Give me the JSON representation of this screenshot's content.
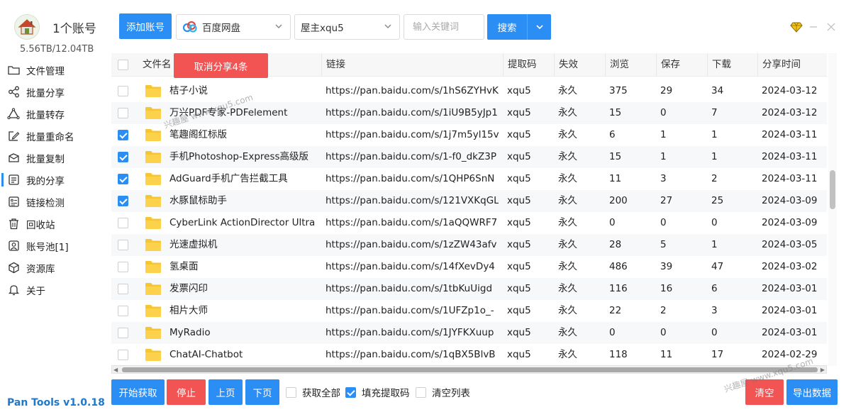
{
  "account": {
    "name": "1个账号",
    "storage": "5.56TB/12.04TB"
  },
  "sidebar": {
    "items": [
      {
        "label": "文件管理",
        "icon": "folder-icon"
      },
      {
        "label": "批量分享",
        "icon": "share-icon"
      },
      {
        "label": "批量转存",
        "icon": "transfer-icon"
      },
      {
        "label": "批量重命名",
        "icon": "rename-icon"
      },
      {
        "label": "批量复制",
        "icon": "copy-icon"
      },
      {
        "label": "我的分享",
        "icon": "my-share-icon"
      },
      {
        "label": "链接检测",
        "icon": "link-check-icon"
      },
      {
        "label": "回收站",
        "icon": "trash-icon"
      },
      {
        "label": "账号池[1]",
        "icon": "account-pool-icon"
      },
      {
        "label": "资源库",
        "icon": "cube-icon"
      },
      {
        "label": "关于",
        "icon": "bell-icon"
      }
    ],
    "active_index": 5
  },
  "version": "Pan Tools v1.0.18",
  "toolbar": {
    "add_account": "添加账号",
    "pan_select": "百度网盘",
    "user_select": "屋主xqu5",
    "search_placeholder": "输入关键词",
    "search_label": "搜索"
  },
  "table": {
    "headers": [
      "文件名",
      "链接",
      "提取码",
      "失效",
      "浏览",
      "保存",
      "下载",
      "分享时间"
    ],
    "cancel_share_label": "取消分享4条",
    "rows": [
      {
        "checked": false,
        "name": "桔子小说",
        "link": "https://pan.baidu.com/s/1hS6ZYHvK",
        "code": "xqu5",
        "expire": "永久",
        "views": "375",
        "saves": "29",
        "downloads": "34",
        "time": "2024-03-12"
      },
      {
        "checked": false,
        "name": "万兴PDF专家-PDFelement",
        "link": "https://pan.baidu.com/s/1iU9B5yJp1",
        "code": "xqu5",
        "expire": "永久",
        "views": "15",
        "saves": "0",
        "downloads": "7",
        "time": "2024-03-12"
      },
      {
        "checked": true,
        "name": "笔趣阁红标版",
        "link": "https://pan.baidu.com/s/1j7m5yl15v",
        "code": "xqu5",
        "expire": "永久",
        "views": "6",
        "saves": "1",
        "downloads": "1",
        "time": "2024-03-11"
      },
      {
        "checked": true,
        "name": "手机Photoshop-Express高级版",
        "link": "https://pan.baidu.com/s/1-f0_dkZ3P",
        "code": "xqu5",
        "expire": "永久",
        "views": "15",
        "saves": "1",
        "downloads": "1",
        "time": "2024-03-11"
      },
      {
        "checked": true,
        "name": "AdGuard手机广告拦截工具",
        "link": "https://pan.baidu.com/s/1QHP6SnN",
        "code": "xqu5",
        "expire": "永久",
        "views": "11",
        "saves": "3",
        "downloads": "2",
        "time": "2024-03-11"
      },
      {
        "checked": true,
        "name": "水豚鼠标助手",
        "link": "https://pan.baidu.com/s/121VXKqGL",
        "code": "xqu5",
        "expire": "永久",
        "views": "200",
        "saves": "27",
        "downloads": "25",
        "time": "2024-03-09"
      },
      {
        "checked": false,
        "name": "CyberLink ActionDirector Ultra",
        "link": "https://pan.baidu.com/s/1aQQWRF7",
        "code": "xqu5",
        "expire": "永久",
        "views": "0",
        "saves": "0",
        "downloads": "0",
        "time": "2024-03-09"
      },
      {
        "checked": false,
        "name": "光速虚拟机",
        "link": "https://pan.baidu.com/s/1zZW43afv",
        "code": "xqu5",
        "expire": "永久",
        "views": "28",
        "saves": "5",
        "downloads": "1",
        "time": "2024-03-05"
      },
      {
        "checked": false,
        "name": "氢桌面",
        "link": "https://pan.baidu.com/s/14fXevDy4",
        "code": "xqu5",
        "expire": "永久",
        "views": "486",
        "saves": "39",
        "downloads": "47",
        "time": "2024-03-02"
      },
      {
        "checked": false,
        "name": "发票闪印",
        "link": "https://pan.baidu.com/s/1tbKuUigd",
        "code": "xqu5",
        "expire": "永久",
        "views": "116",
        "saves": "16",
        "downloads": "6",
        "time": "2024-03-01"
      },
      {
        "checked": false,
        "name": "相片大师",
        "link": "https://pan.baidu.com/s/1UFZp1o_-",
        "code": "xqu5",
        "expire": "永久",
        "views": "22",
        "saves": "2",
        "downloads": "3",
        "time": "2024-03-01"
      },
      {
        "checked": false,
        "name": "MyRadio",
        "link": "https://pan.baidu.com/s/1JYFKXuup",
        "code": "xqu5",
        "expire": "永久",
        "views": "0",
        "saves": "0",
        "downloads": "0",
        "time": "2024-03-01"
      },
      {
        "checked": false,
        "name": "ChatAI-Chatbot",
        "link": "https://pan.baidu.com/s/1qBX5BlvB",
        "code": "xqu5",
        "expire": "永久",
        "views": "118",
        "saves": "11",
        "downloads": "17",
        "time": "2024-02-29"
      }
    ]
  },
  "bottom": {
    "start_label": "开始获取",
    "stop_label": "停止",
    "prev_label": "上页",
    "next_label": "下页",
    "fetch_all": {
      "label": "获取全部",
      "checked": false
    },
    "fill_code": {
      "label": "填充提取码",
      "checked": true
    },
    "clear_list": {
      "label": "清空列表",
      "checked": false
    },
    "clear_label": "清空",
    "export_label": "导出数据"
  },
  "watermarks": [
    "兴趣屋 www.xqu5.com",
    "兴趣屋 www.xqu5.com"
  ],
  "colors": {
    "primary": "#2a8ef5",
    "danger": "#f25353",
    "brand_text": "#1f78c8"
  }
}
